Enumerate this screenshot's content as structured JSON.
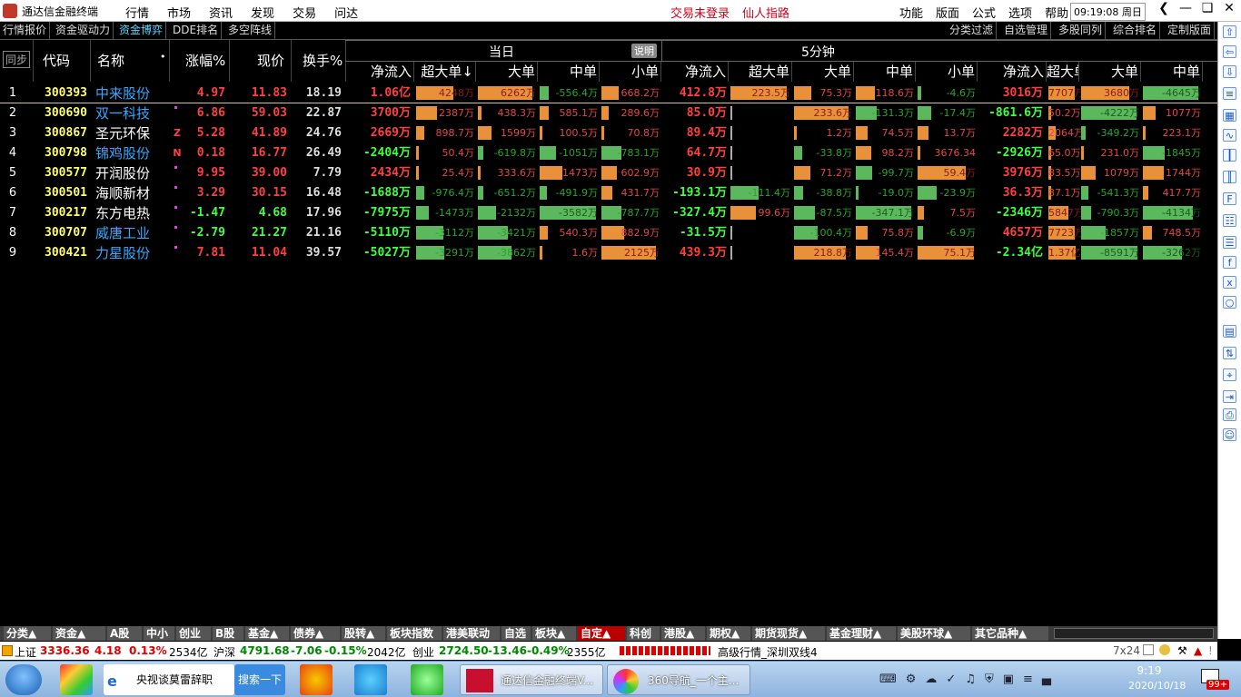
{
  "title_bar": {
    "app_title": "通达信金融终端",
    "menu": [
      "行情",
      "市场",
      "资讯",
      "发现",
      "交易",
      "问达"
    ],
    "warnings": [
      "交易未登录",
      "仙人指路"
    ],
    "right_menu": [
      "功能",
      "版面",
      "公式",
      "选项",
      "帮助"
    ],
    "clock": "09:19:08 周日"
  },
  "toolbar": {
    "left": [
      "行情报价",
      "资金驱动力",
      "资金博弈",
      "DDE排名",
      "多空阵线"
    ],
    "active": "资金博弈",
    "right": [
      "分类过滤",
      "自选管理",
      "多股同列",
      "综合排名",
      "定制版面"
    ]
  },
  "table": {
    "sync_label": "同步",
    "col_code": "代码",
    "col_name": "名称",
    "col_change": "涨幅%",
    "col_price": "现价",
    "col_turnover": "换手%",
    "group_day": "当日",
    "group_day_note": "说明",
    "group_5min": "5分钟",
    "sub_day": [
      "净流入",
      "超大单↓",
      "大单",
      "中单",
      "小单"
    ],
    "sub_5min": [
      "净流入",
      "超大单",
      "大单",
      "中单",
      "小单"
    ],
    "sub_extra": [
      "净流入",
      "超大单",
      "大单",
      "中单"
    ],
    "rows": [
      {
        "idx": "1",
        "code": "300393",
        "name": "中来股份",
        "flag": "",
        "change": "4.97",
        "price": "11.83",
        "turnover": "18.19",
        "dnet": "1.06亿",
        "d1": "4248万",
        "d2": "6262万",
        "d3": "-556.4万",
        "d4": "668.2万",
        "fnet": "412.8万",
        "f1": "223.5万",
        "f2": "75.3万",
        "f3": "118.6万",
        "f4": "-4.6万",
        "xnet": "3016万",
        "x1": "7707万",
        "x2": "3680万",
        "x3": "-4645万"
      },
      {
        "idx": "2",
        "code": "300690",
        "name": "双一科技",
        "flag": "",
        "change": "6.86",
        "price": "59.03",
        "turnover": "22.87",
        "dnet": "3700万",
        "d1": "2387万",
        "d2": "438.3万",
        "d3": "585.1万",
        "d4": "289.6万",
        "fnet": "85.0万",
        "f1": "",
        "f2": "233.6万",
        "f3": "-131.3万",
        "f4": "-17.4万",
        "xnet": "-861.6万",
        "x1": "50.2万",
        "x2": "-4222万",
        "x3": "1077万"
      },
      {
        "idx": "3",
        "code": "300867",
        "name": "圣元环保",
        "flag": "Z",
        "change": "5.28",
        "price": "41.89",
        "turnover": "24.76",
        "dnet": "2669万",
        "d1": "898.7万",
        "d2": "1599万",
        "d3": "100.5万",
        "d4": "70.8万",
        "fnet": "89.4万",
        "f1": "",
        "f2": "1.2万",
        "f3": "74.5万",
        "f4": "13.7万",
        "xnet": "2282万",
        "x1": "2064万",
        "x2": "-349.2万",
        "x3": "223.1万"
      },
      {
        "idx": "4",
        "code": "300798",
        "name": "锦鸡股份",
        "flag": "N",
        "change": "0.18",
        "price": "16.77",
        "turnover": "26.49",
        "dnet": "-2404万",
        "d1": "50.4万",
        "d2": "-619.8万",
        "d3": "-1051万",
        "d4": "-783.1万",
        "fnet": "64.7万",
        "f1": "",
        "f2": "-33.8万",
        "f3": "98.2万",
        "f4": "3676.34",
        "xnet": "-2926万",
        "x1": "65.0万",
        "x2": "231.0万",
        "x3": "-1845万"
      },
      {
        "idx": "5",
        "code": "300577",
        "name": "开润股份",
        "flag": "",
        "change": "9.95",
        "price": "39.00",
        "turnover": "7.79",
        "dnet": "2434万",
        "d1": "25.4万",
        "d2": "333.6万",
        "d3": "1473万",
        "d4": "602.9万",
        "fnet": "30.9万",
        "f1": "",
        "f2": "71.2万",
        "f3": "-99.7万",
        "f4": "59.4万",
        "xnet": "3976万",
        "x1": "83.5万",
        "x2": "1079万",
        "x3": "1744万"
      },
      {
        "idx": "6",
        "code": "300501",
        "name": "海顺新材",
        "flag": "",
        "change": "3.29",
        "price": "30.15",
        "turnover": "16.48",
        "dnet": "-1688万",
        "d1": "-976.4万",
        "d2": "-651.2万",
        "d3": "-491.9万",
        "d4": "431.7万",
        "fnet": "-193.1万",
        "f1": "-111.4万",
        "f2": "-38.8万",
        "f3": "-19.0万",
        "f4": "-23.9万",
        "xnet": "36.3万",
        "x1": "87.1万",
        "x2": "-541.3万",
        "x3": "417.7万"
      },
      {
        "idx": "7",
        "code": "300217",
        "name": "东方电热",
        "flag": "",
        "change": "-1.47",
        "price": "4.68",
        "turnover": "17.96",
        "dnet": "-7975万",
        "d1": "-1473万",
        "d2": "-2132万",
        "d3": "-3582万",
        "d4": "-787.7万",
        "fnet": "-327.4万",
        "f1": "99.6万",
        "f2": "-87.5万",
        "f3": "-347.1万",
        "f4": "7.5万",
        "xnet": "-2346万",
        "x1": "5847万",
        "x2": "-790.3万",
        "x3": "-4134万"
      },
      {
        "idx": "8",
        "code": "300707",
        "name": "威唐工业",
        "flag": "",
        "change": "-2.79",
        "price": "21.27",
        "turnover": "21.16",
        "dnet": "-5110万",
        "d1": "-3112万",
        "d2": "-3421万",
        "d3": "540.3万",
        "d4": "882.9万",
        "fnet": "-31.5万",
        "f1": "",
        "f2": "-100.4万",
        "f3": "75.8万",
        "f4": "-6.9万",
        "xnet": "4657万",
        "x1": "7723万",
        "x2": "-1857万",
        "x3": "748.5万"
      },
      {
        "idx": "9",
        "code": "300421",
        "name": "力星股份",
        "flag": "",
        "change": "7.81",
        "price": "11.04",
        "turnover": "39.57",
        "dnet": "-5027万",
        "d1": "-3291万",
        "d2": "-3862万",
        "d3": "1.6万",
        "d4": "2125万",
        "fnet": "439.3万",
        "f1": "",
        "f2": "218.8万",
        "f3": "145.4万",
        "f4": "75.1万",
        "xnet": "-2.34亿",
        "x1": "1.37亿",
        "x2": "-8591万",
        "x3": "-3262万"
      }
    ]
  },
  "bottom_tabs": [
    "分类▲",
    "资金▲",
    "A股",
    "中小",
    "创业",
    "B股",
    "基金▲",
    "债券▲",
    "股转▲",
    "板块指数",
    "港美联动",
    "自选",
    "板块▲",
    "自定▲",
    "科创",
    "港股▲",
    "期权▲",
    "期货现货▲",
    "基金理财▲",
    "美股环球▲",
    "其它品种▲"
  ],
  "bottom_active": "自定▲",
  "index_bar": {
    "sh_label": "上证",
    "sh_value": "3336.36",
    "sh_chg": "4.18",
    "sh_pct": "0.13%",
    "sh_amt": "2534亿",
    "hs_label": "沪深",
    "hs_value": "4791.68",
    "hs_chg": "-7.06",
    "hs_pct": "-0.15%",
    "hs_amt": "2042亿",
    "cy_label": "创业",
    "cy_value": "2724.50",
    "cy_chg": "-13.46",
    "cy_pct": "-0.49%",
    "cy_amt": "2355亿",
    "server": "高级行情_深圳双线4",
    "mode": "7x24"
  },
  "taskbar": {
    "search_text": "央视谈莫雷辞职",
    "search_button": "搜索一下",
    "win1": "通达信金融终端V...",
    "win2": "360导航_一个主...",
    "time": "9:19",
    "date": "2020/10/18",
    "badge": "99+"
  },
  "colors": {
    "up": "#ff4040",
    "down": "#40ff40",
    "name": "#33aaff",
    "code": "#ffff66",
    "bar_pos": "#e8913a",
    "bar_neg": "#5cb85c"
  }
}
